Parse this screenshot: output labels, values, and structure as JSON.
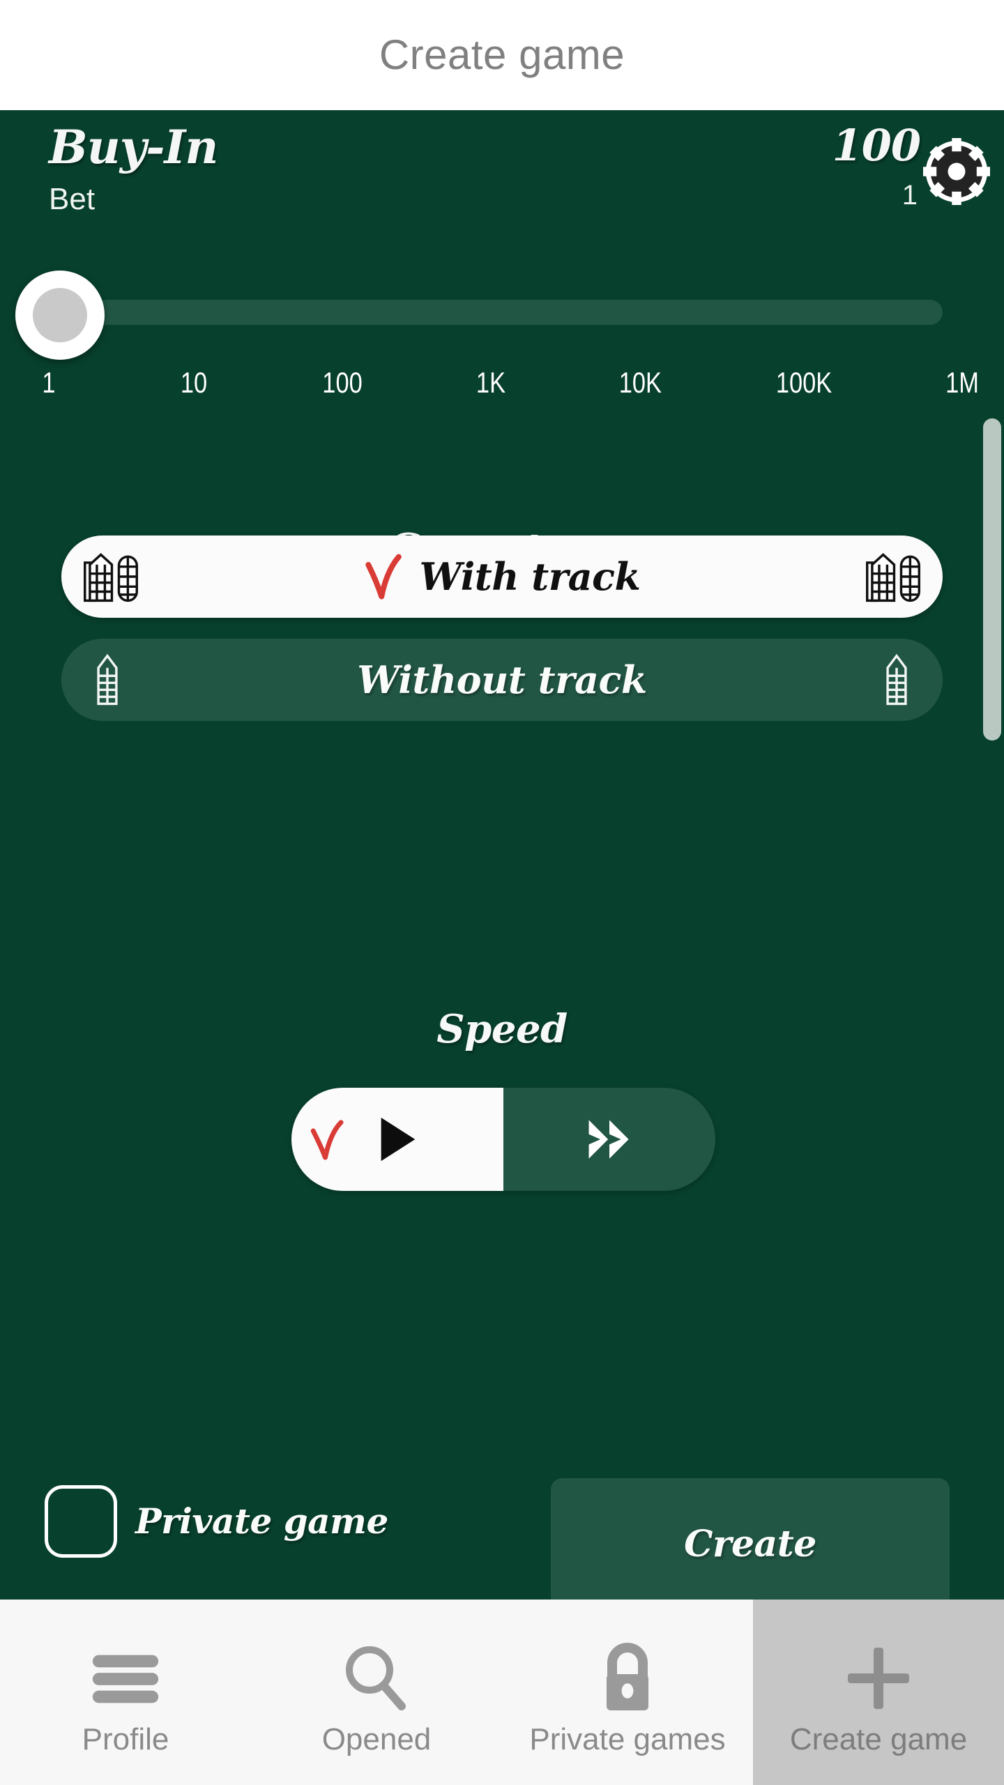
{
  "header": {
    "title": "Create game"
  },
  "buyin": {
    "title": "Buy-In",
    "subtitle": "Bet",
    "amount": "100",
    "chip_count": "1",
    "chip_icon": "poker-chip-icon"
  },
  "slider": {
    "value_label": "1",
    "ticks": [
      "1",
      "10",
      "100",
      "1K",
      "10K",
      "100K",
      "1M"
    ],
    "thumb_position_pct": 0,
    "track_color": "#215544",
    "thumb_color": "#ffffff"
  },
  "game_type": {
    "heading": "Game type",
    "options": [
      {
        "label": "With track",
        "selected": true,
        "icon": "board-with-track-icon",
        "check": "red-check-icon"
      },
      {
        "label": "Without track",
        "selected": false,
        "icon": "board-without-track-icon",
        "check": ""
      }
    ]
  },
  "speed": {
    "heading": "Speed",
    "options": [
      {
        "icon": "play-icon",
        "selected": true,
        "check": "red-check-icon"
      },
      {
        "icon": "fast-forward-icon",
        "selected": false,
        "check": ""
      }
    ]
  },
  "footer": {
    "private_game_label": "Private game",
    "private_game_checked": false,
    "create_label": "Create"
  },
  "bottom_nav": {
    "items": [
      {
        "label": "Profile",
        "icon": "hamburger-menu-icon",
        "active": false
      },
      {
        "label": "Opened",
        "icon": "search-icon",
        "active": false
      },
      {
        "label": "Private games",
        "icon": "lock-icon",
        "active": false
      },
      {
        "label": "Create game",
        "icon": "plus-icon",
        "active": true
      }
    ]
  },
  "colors": {
    "board_green": "#07402C",
    "panel_green": "#215544",
    "accent_red": "#d93b35",
    "nav_gray": "#8a8a8a",
    "header_gray": "#808080"
  }
}
